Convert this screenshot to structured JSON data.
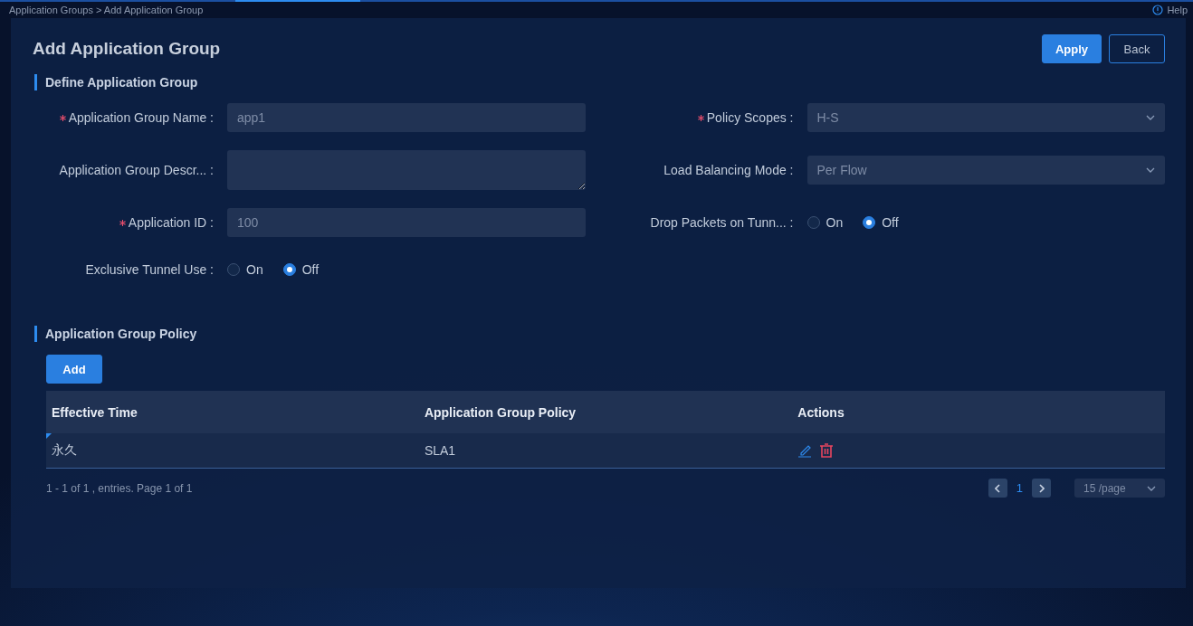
{
  "breadcrumb": "Application Groups > Add Application Group",
  "help": "Help",
  "title": "Add Application Group",
  "buttons": [
    {
      "label": "Apply",
      "kind": "primary"
    },
    {
      "label": "Back",
      "kind": "outline"
    }
  ],
  "define_section": {
    "title": "Define Application Group",
    "rows": [
      [
        {
          "label": "Application Group Name :",
          "required": true,
          "kind": "input",
          "value": "app1"
        },
        {
          "label": "Policy Scopes :",
          "required": true,
          "kind": "select",
          "value": "H-S"
        }
      ],
      [
        {
          "label": "Application Group Descr... :",
          "required": false,
          "kind": "textarea"
        },
        {
          "label": "Load Balancing Mode :",
          "required": false,
          "kind": "select",
          "value": "Per Flow"
        }
      ],
      [
        {
          "label": "Application ID :",
          "required": true,
          "kind": "input",
          "value": "100"
        },
        {
          "label": "Drop Packets on Tunn... :",
          "required": false,
          "kind": "radio",
          "options": [
            {
              "label": "On",
              "selected": false
            },
            {
              "label": "Off",
              "selected": true
            }
          ]
        }
      ],
      [
        {
          "label": "Exclusive Tunnel Use :",
          "required": false,
          "kind": "radio",
          "options": [
            {
              "label": "On",
              "selected": false
            },
            {
              "label": "Off",
              "selected": true
            }
          ]
        }
      ]
    ]
  },
  "policy_section": {
    "title": "Application Group Policy",
    "add_button": "Add",
    "table": {
      "columns": [
        "Effective Time",
        "Application Group Policy",
        "Actions"
      ],
      "rows": [
        {
          "cells": [
            "永久",
            "SLA1"
          ]
        }
      ]
    },
    "pagination": {
      "summary": "1 - 1 of 1 , entries. Page 1 of 1",
      "page": "1",
      "per_page": "15 /page"
    }
  }
}
